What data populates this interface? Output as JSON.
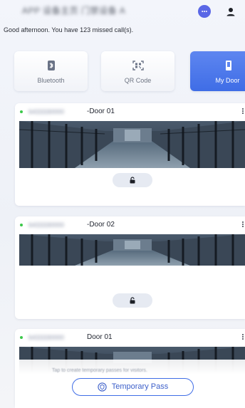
{
  "header": {
    "title": "APP 设备主页 门禁设备 A",
    "greeting": "Good afternoon. You have 123 missed call(s).",
    "chat_icon": "chat-bubble-icon",
    "profile_icon": "person-icon",
    "accent_color": "#5a67e6"
  },
  "tabs": [
    {
      "label": "Bluetooth",
      "icon": "bluetooth-icon",
      "selected": false
    },
    {
      "label": "QR Code",
      "icon": "qr-code-icon",
      "selected": false
    },
    {
      "label": "My Door",
      "icon": "door-icon",
      "selected": true
    }
  ],
  "doors": [
    {
      "serial": "6433330000",
      "name": "-Door 01",
      "online": true,
      "status_color": "#3cc84a",
      "unlock_icon": "unlock-icon",
      "menu_icon": "more-vertical-icon"
    },
    {
      "serial": "6433330000",
      "name": "-Door 02",
      "online": true,
      "status_color": "#3cc84a",
      "unlock_icon": "unlock-icon",
      "menu_icon": "more-vertical-icon"
    },
    {
      "serial": "6433330000",
      "name": "Door 01",
      "online": true,
      "status_color": "#3cc84a",
      "unlock_icon": "unlock-icon",
      "menu_icon": "more-vertical-icon"
    }
  ],
  "temporary_pass": {
    "hint": "Tap to create temporary passes for visitors.",
    "label": "Temporary Pass",
    "icon": "shield-pass-icon",
    "accent_color": "#3f6de6"
  }
}
